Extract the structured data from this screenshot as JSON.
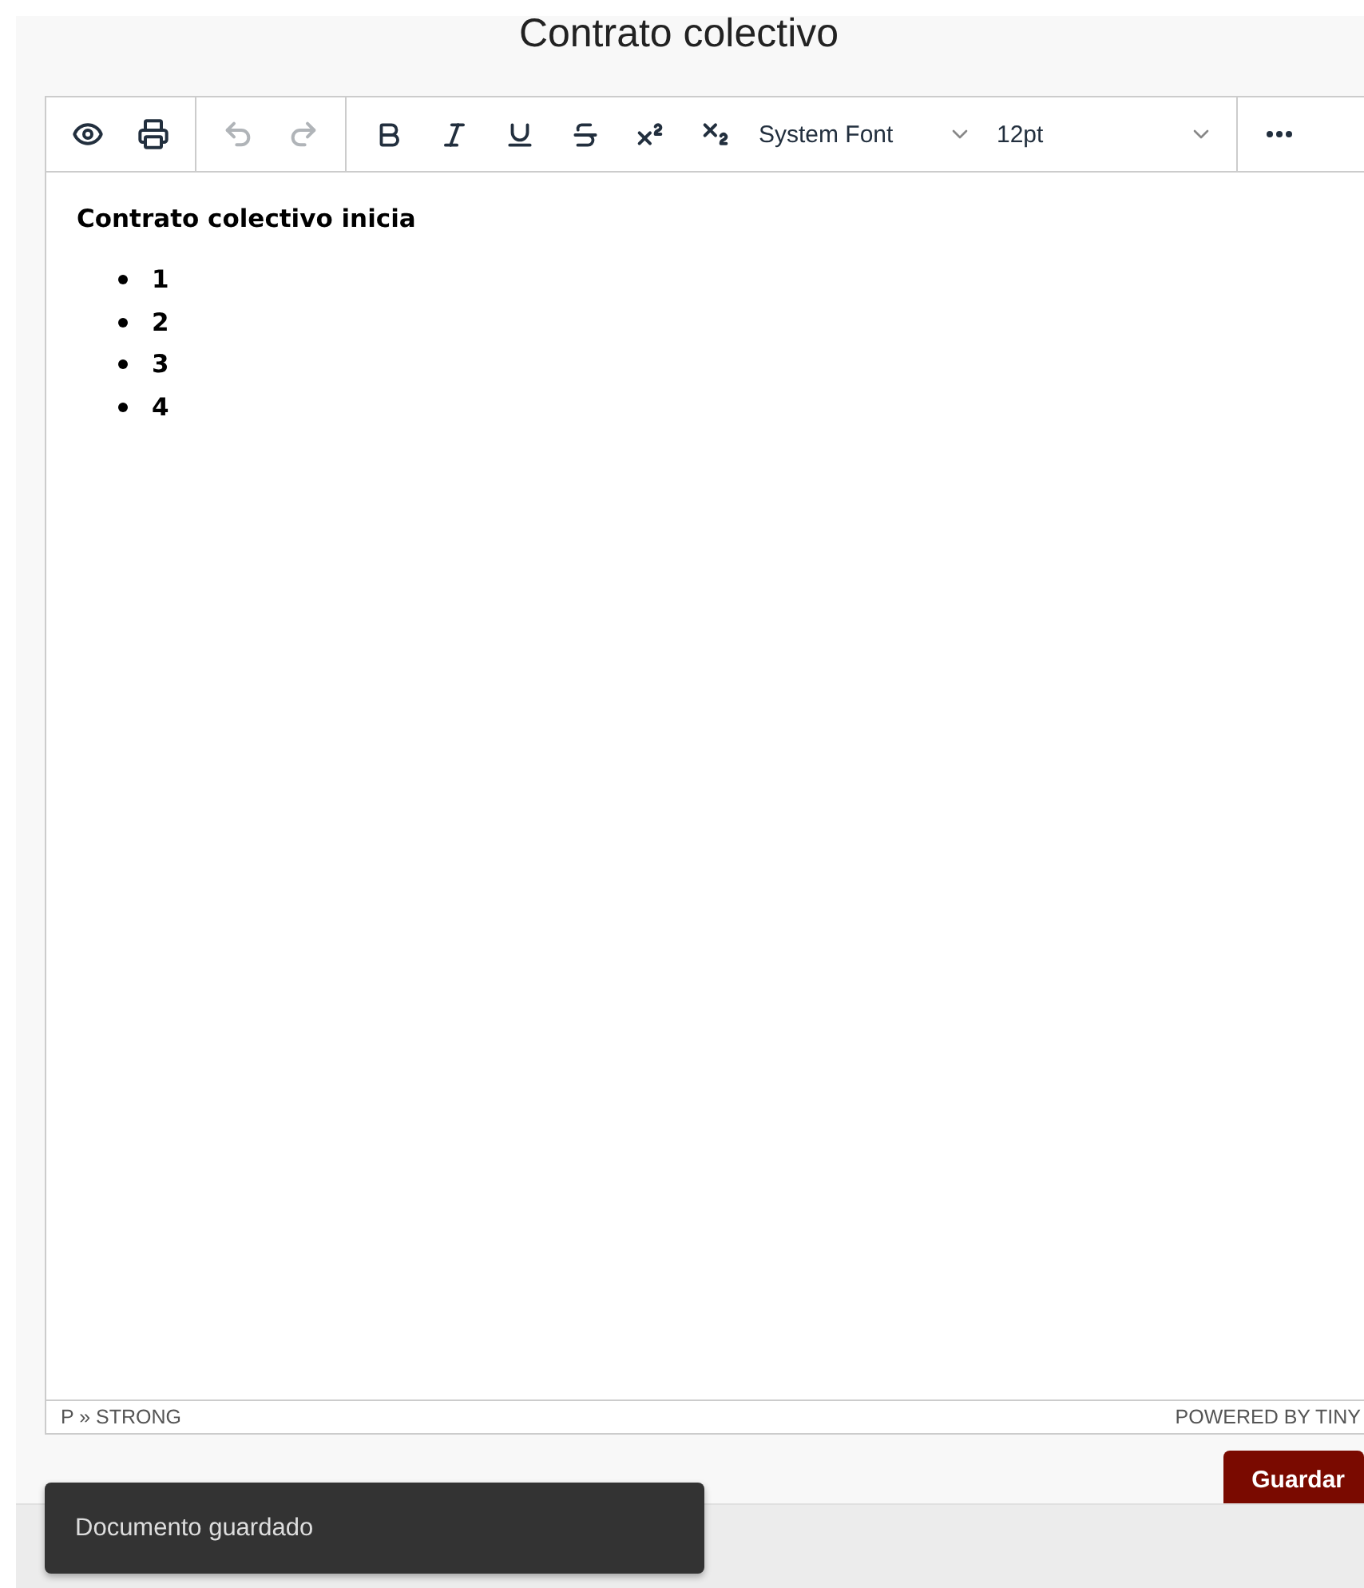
{
  "title": "Contrato colectivo",
  "toolbar": {
    "groups": [
      [
        {
          "kind": "preview",
          "disabled": false
        },
        {
          "kind": "print",
          "disabled": false
        }
      ],
      [
        {
          "kind": "undo",
          "disabled": true
        },
        {
          "kind": "redo",
          "disabled": true
        }
      ],
      [
        {
          "kind": "bold",
          "disabled": false
        },
        {
          "kind": "italic",
          "disabled": false
        },
        {
          "kind": "underline",
          "disabled": false
        },
        {
          "kind": "strikethrough",
          "disabled": false
        },
        {
          "kind": "superscript",
          "disabled": false
        },
        {
          "kind": "subscript",
          "disabled": false
        }
      ]
    ],
    "font_select": {
      "value": "System Font"
    },
    "size_select": {
      "value": "12pt"
    },
    "more": {
      "kind": "more",
      "disabled": false
    }
  },
  "content": {
    "heading": "Contrato colectivo inicia",
    "list_items": [
      "1",
      "2",
      "3",
      "4"
    ]
  },
  "status_bar": {
    "path": "P » STRONG",
    "branding": "POWERED BY TINY"
  },
  "save_button": {
    "label": "Guardar"
  },
  "toast": {
    "message": "Documento guardado"
  }
}
